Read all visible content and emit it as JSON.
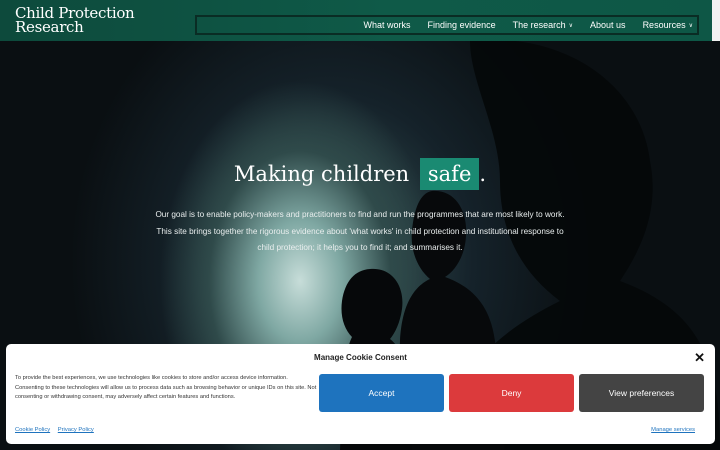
{
  "header": {
    "logo_line1": "Child Protection",
    "logo_line2": "Research",
    "nav": [
      {
        "label": "What works",
        "has_dropdown": false
      },
      {
        "label": "Finding evidence",
        "has_dropdown": false
      },
      {
        "label": "The research",
        "has_dropdown": true
      },
      {
        "label": "About us",
        "has_dropdown": false
      },
      {
        "label": "Resources",
        "has_dropdown": true
      }
    ]
  },
  "hero": {
    "headline_prefix": "Making children",
    "headline_highlight": "safe",
    "headline_suffix": ".",
    "intro": "Our goal is to enable policy-makers and practitioners to find and run the programmes that are most likely to work. This site brings together the rigorous evidence about 'what works' in child protection and institutional response to child protection; it helps you to find it; and summarises it."
  },
  "cookie": {
    "title": "Manage Cookie Consent",
    "close_icon": "close-icon",
    "text": "To provide the best experiences, we use technologies like cookies to store and/or access device information. Consenting to these technologies will allow us to process data such as browsing behavior or unique IDs on this site. Not consenting or withdrawing consent, may adversely affect certain features and functions.",
    "accept": "Accept",
    "deny": "Deny",
    "preferences": "View preferences",
    "cookie_policy": "Cookie Policy",
    "privacy_policy": "Privacy Policy",
    "manage_services": "Manage services"
  },
  "colors": {
    "header_green": "#0f5a48",
    "highlight_green": "#1a8a72",
    "accept_blue": "#1e73be",
    "deny_red": "#dc3a3c",
    "prefs_gray": "#444444"
  }
}
